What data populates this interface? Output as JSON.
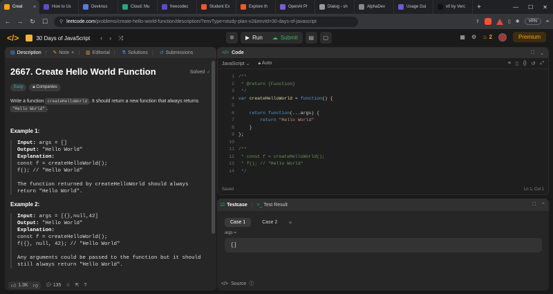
{
  "browser": {
    "tabs": [
      {
        "label": "Creat",
        "color": "#ffa116",
        "active": true
      },
      {
        "label": "How to Us",
        "color": "#5a4bd1"
      },
      {
        "label": "Devknus",
        "color": "#5b7ad9"
      },
      {
        "label": "Cloud: Mu",
        "color": "#2aa876"
      },
      {
        "label": "freecodec",
        "color": "#5a4bd1"
      },
      {
        "label": "Student Ex",
        "color": "#f05a28"
      },
      {
        "label": "Explore th",
        "color": "#f05a28"
      },
      {
        "label": "OpenAI Pl",
        "color": "#7b5bd6"
      },
      {
        "label": "Dialog - sh",
        "color": "#999999"
      },
      {
        "label": "AlphaDev",
        "color": "#888888"
      },
      {
        "label": "Usage Gui",
        "color": "#6b5bd6"
      },
      {
        "label": "v0 by Verc",
        "color": "#111111"
      }
    ],
    "url_host": "leetcode.com",
    "url_path": "/problems/create-hello-world-function/description/?envType=study-plan-v2&envId=30-days-of-javascript",
    "vpn_label": "VPN"
  },
  "header": {
    "plan_title": "30 Days of JavaScript",
    "run_label": "Run",
    "submit_label": "Submit",
    "streak": "2",
    "premium_label": "Premium"
  },
  "left": {
    "tabs": [
      "Description",
      "Note",
      "Editorial",
      "Solutions",
      "Submissions"
    ],
    "title": "2667. Create Hello World Function",
    "solved_label": "Solved",
    "difficulty": "Easy",
    "companies_label": "Companies",
    "desc_1": "Write a function ",
    "desc_code_1": "createHelloWorld",
    "desc_2": ". It should return a new function that always returns ",
    "desc_code_2": "\"Hello World\"",
    "desc_3": ".",
    "example1_title": "Example 1:",
    "example1": {
      "input": "args = []",
      "output": "\"Hello World\"",
      "code1": "const f = createHelloWorld();",
      "code2": "f(); // \"Hello World\"",
      "note1": "The function returned by createHelloWorld should always",
      "note2": "return \"Hello World\"."
    },
    "example2_title": "Example 2:",
    "example2": {
      "input": "args = [{},null,42]",
      "output": "\"Hello World\"",
      "code1": "const f = createHelloWorld();",
      "code2": "f({}, null, 42); // \"Hello World\"",
      "note1": "Any arguments could be passed to the function but it should",
      "note2": "still always return \"Hello World\"."
    },
    "input_label": "Input:",
    "output_label": "Output:",
    "explanation_label": "Explanation:",
    "likes": "1.3K",
    "comments": "135"
  },
  "code": {
    "title": "Code",
    "language": "JavaScript",
    "mode": "Auto",
    "line_numbers": [
      "1",
      "2",
      "3",
      "4",
      "5",
      "6",
      "7",
      "8",
      "9",
      "10",
      "11",
      "12",
      "13",
      "14"
    ],
    "status_left": "Saved",
    "status_right": "Ln 1, Col 1"
  },
  "test": {
    "tab_testcase": "Testcase",
    "tab_result": "Test Result",
    "case1": "Case 1",
    "case2": "Case 2",
    "args_label": "args =",
    "args_value": "[]",
    "source_label": "Source"
  }
}
